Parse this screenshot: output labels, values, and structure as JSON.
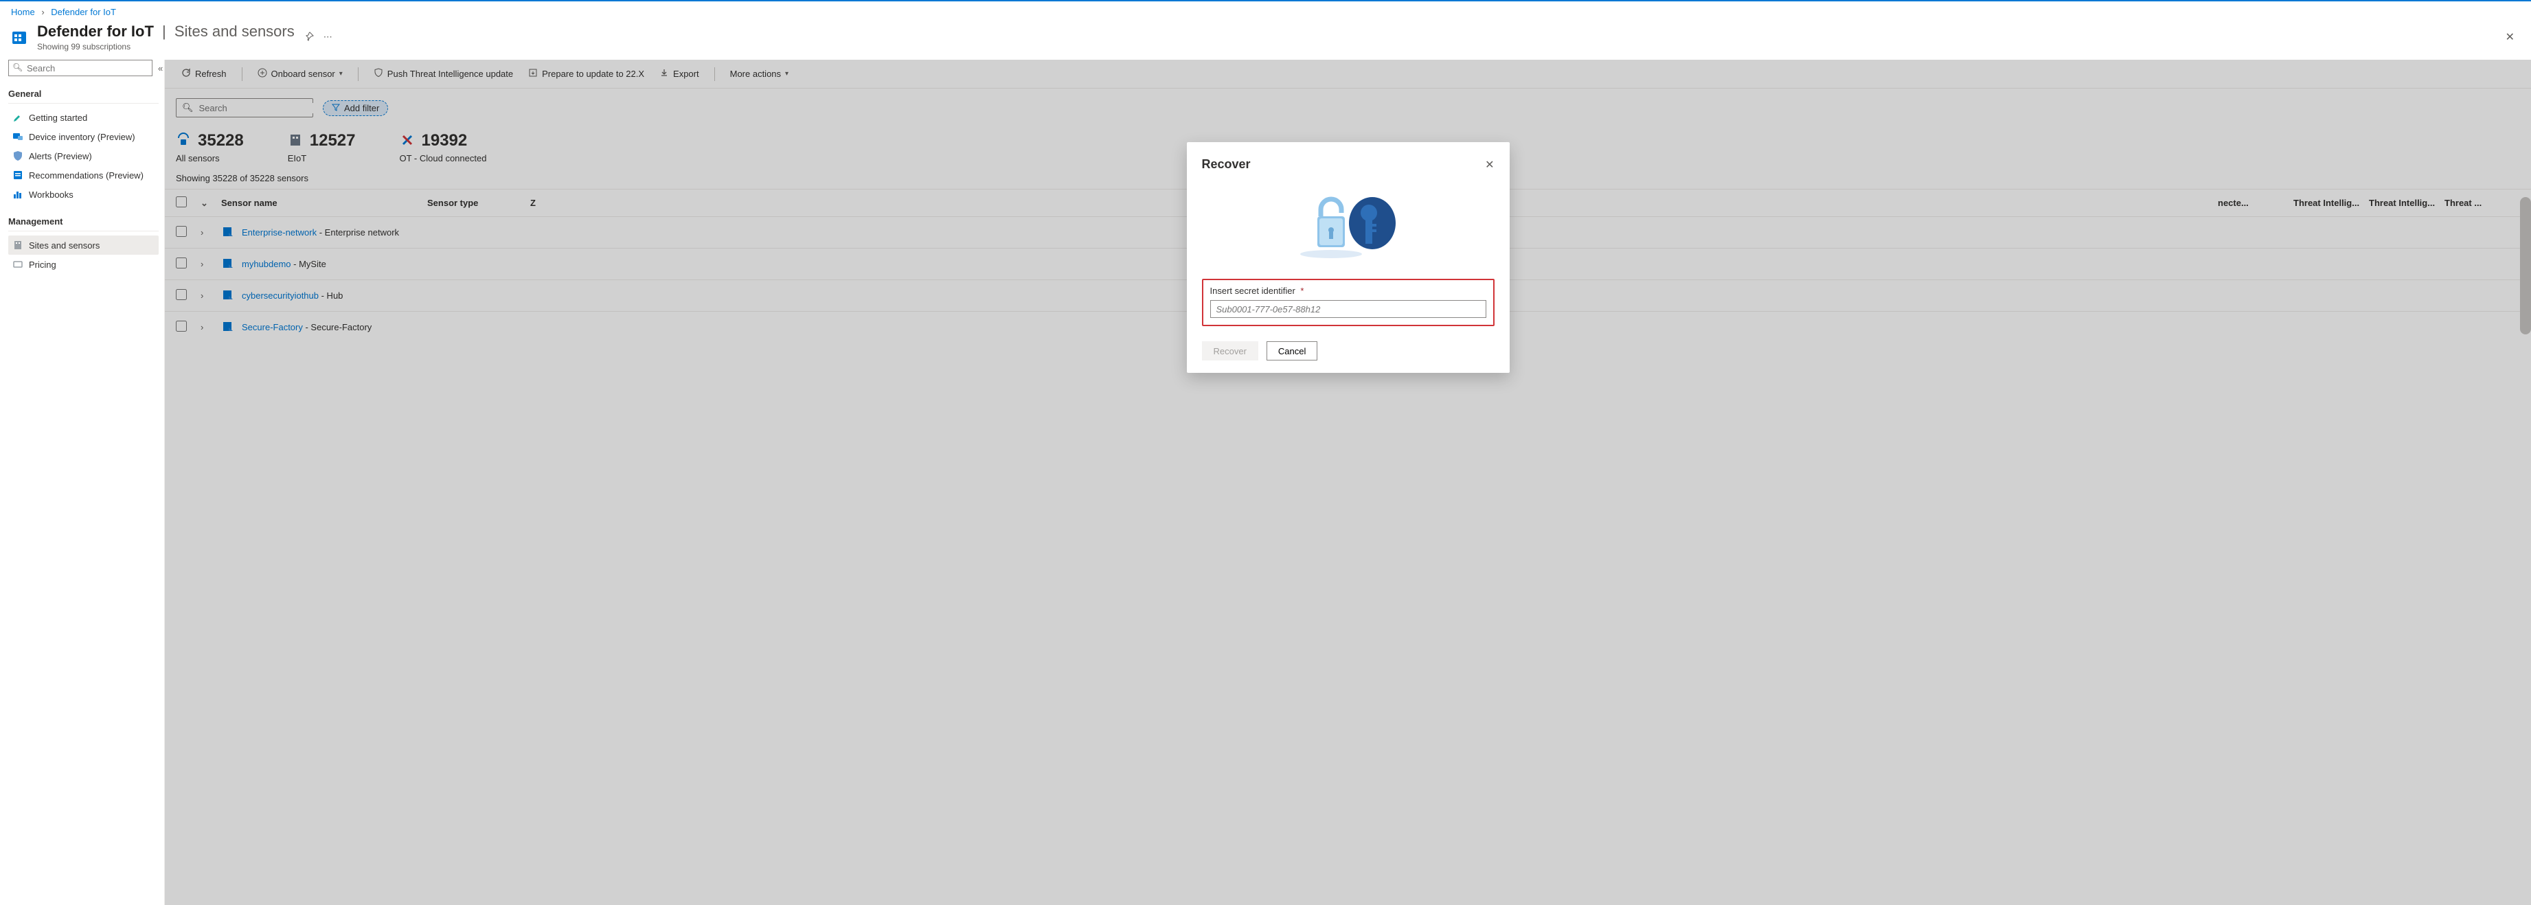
{
  "breadcrumb": {
    "home": "Home",
    "current": "Defender for IoT"
  },
  "header": {
    "title_main": "Defender for IoT",
    "title_sub": "Sites and sensors",
    "meta": "Showing 99 subscriptions"
  },
  "sidebar": {
    "search_placeholder": "Search",
    "group_general": "General",
    "group_management": "Management",
    "items_general": [
      {
        "label": "Getting started"
      },
      {
        "label": "Device inventory (Preview)"
      },
      {
        "label": "Alerts (Preview)"
      },
      {
        "label": "Recommendations (Preview)"
      },
      {
        "label": "Workbooks"
      }
    ],
    "items_management": [
      {
        "label": "Sites and sensors"
      },
      {
        "label": "Pricing"
      }
    ]
  },
  "toolbar": {
    "refresh": "Refresh",
    "onboard": "Onboard sensor",
    "push_ti": "Push Threat Intelligence update",
    "prepare": "Prepare to update to 22.X",
    "export": "Export",
    "more": "More actions"
  },
  "filter": {
    "search_placeholder": "Search",
    "add_filter": "Add filter"
  },
  "stats": {
    "all_sensors_num": "35228",
    "all_sensors_lbl": "All sensors",
    "eiot_num": "12527",
    "eiot_lbl": "EIoT",
    "ot_num": "19392",
    "ot_lbl": "OT - Cloud connected"
  },
  "grid": {
    "showing": "Showing 35228 of 35228 sensors",
    "headers": {
      "name": "Sensor name",
      "type": "Sensor type",
      "zone": "Z",
      "connected": "necte...",
      "ti1": "Threat Intellig...",
      "ti2": "Threat Intellig...",
      "threat": "Threat ..."
    },
    "rows": [
      {
        "link": "Enterprise-network",
        "rest": " - Enterprise network"
      },
      {
        "link": "myhubdemo",
        "rest": " - MySite"
      },
      {
        "link": "cybersecurityiothub",
        "rest": " - Hub"
      },
      {
        "link": "Secure-Factory",
        "rest": " - Secure-Factory"
      }
    ]
  },
  "modal": {
    "title": "Recover",
    "field_label": "Insert secret identifier",
    "placeholder": "Sub0001-777-0e57-88h12",
    "recover_btn": "Recover",
    "cancel_btn": "Cancel"
  }
}
